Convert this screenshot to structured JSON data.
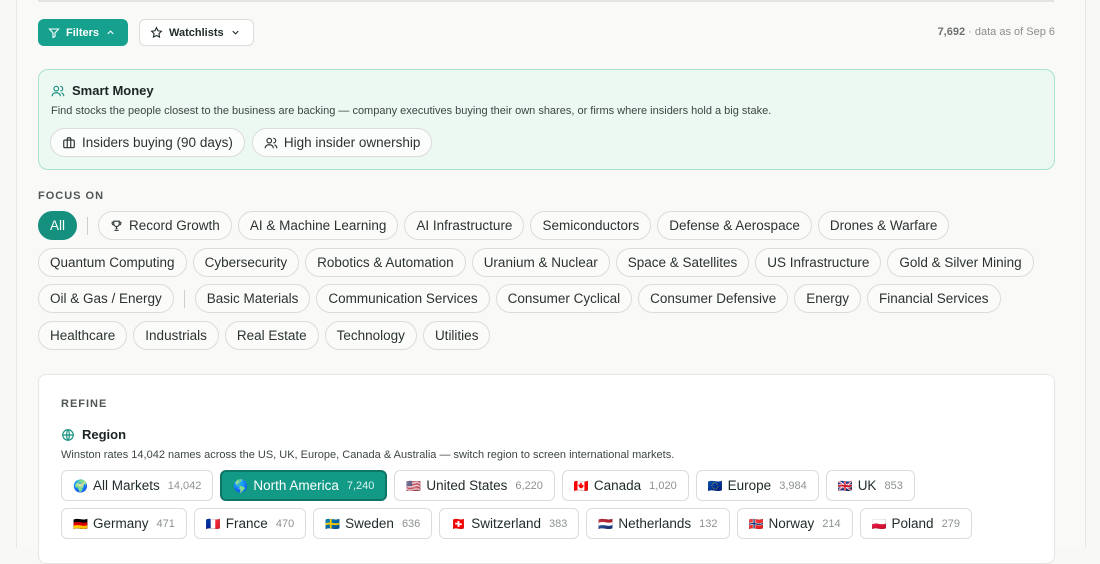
{
  "toolbar": {
    "filters_label": "Filters",
    "watchlists_label": "Watchlists",
    "count": "7,692",
    "data_as_of": "· data as of Sep 6"
  },
  "smart_money": {
    "title": "Smart Money",
    "description": "Find stocks the people closest to the business are backing — company executives buying their own shares, or firms where insiders hold a big stake.",
    "chips": [
      {
        "label": "Insiders buying (90 days)",
        "icon": "briefcase-icon"
      },
      {
        "label": "High insider ownership",
        "icon": "users-icon"
      }
    ]
  },
  "focus": {
    "label": "FOCUS ON",
    "rows": [
      [
        "All",
        "Record Growth",
        "AI & Machine Learning",
        "AI Infrastructure",
        "Semiconductors",
        "Defense & Aerospace",
        "Drones & Warfare"
      ],
      [
        "Quantum Computing",
        "Cybersecurity",
        "Robotics & Automation",
        "Uranium & Nuclear",
        "Space & Satellites",
        "US Infrastructure",
        "Gold & Silver Mining"
      ],
      [
        "Oil & Gas / Energy",
        "Basic Materials",
        "Communication Services",
        "Consumer Cyclical",
        "Consumer Defensive",
        "Energy",
        "Financial Services"
      ],
      [
        "Healthcare",
        "Industrials",
        "Real Estate",
        "Technology",
        "Utilities"
      ]
    ]
  },
  "refine": {
    "label": "REFINE",
    "region_title": "Region",
    "region_desc": "Winston rates 14,042 names across the US, UK, Europe, Canada & Australia — switch region to screen international markets.",
    "regions_row1": [
      {
        "flag": "🌍",
        "name": "All Markets",
        "count": "14,042"
      },
      {
        "flag": "🌎",
        "name": "North America",
        "count": "7,240"
      },
      {
        "flag": "🇺🇸",
        "name": "United States",
        "count": "6,220"
      },
      {
        "flag": "🇨🇦",
        "name": "Canada",
        "count": "1,020"
      },
      {
        "flag": "🇪🇺",
        "name": "Europe",
        "count": "3,984"
      },
      {
        "flag": "🇬🇧",
        "name": "UK",
        "count": "853"
      }
    ],
    "regions_row2": [
      {
        "flag": "🇩🇪",
        "name": "Germany",
        "count": "471"
      },
      {
        "flag": "🇫🇷",
        "name": "France",
        "count": "470"
      },
      {
        "flag": "🇸🇪",
        "name": "Sweden",
        "count": "636"
      },
      {
        "flag": "🇨🇭",
        "name": "Switzerland",
        "count": "383"
      },
      {
        "flag": "🇳🇱",
        "name": "Netherlands",
        "count": "132"
      },
      {
        "flag": "🇳🇴",
        "name": "Norway",
        "count": "214"
      },
      {
        "flag": "🇵🇱",
        "name": "Poland",
        "count": "279"
      }
    ]
  },
  "colors": {
    "accent": "#16a08e",
    "smart_bg": "#ecf8f2",
    "smart_border": "#a9e3cc"
  }
}
